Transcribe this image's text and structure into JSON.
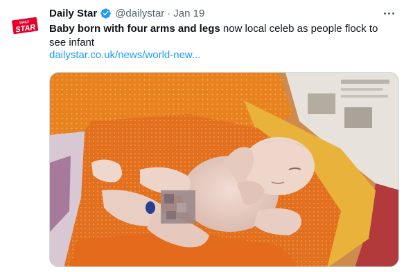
{
  "tweet": {
    "author_name": "Daily Star",
    "handle": "@dailystar",
    "separator": "·",
    "date": "Jan 19",
    "text_bold": "Baby born with four arms and legs",
    "text_rest": " now local celeb as people flock to see infant",
    "link": "dailystar.co.uk/news/world-new..."
  },
  "avatar": {
    "logo_text_top": "DAILY",
    "logo_text_main": "STAR",
    "color": "#e4002b"
  },
  "icons": {
    "verified": "verified-badge-icon",
    "more": "more-options-icon"
  },
  "colors": {
    "link": "#1d9bf0",
    "verified": "#1d9bf0",
    "secondary_text": "#536471"
  }
}
